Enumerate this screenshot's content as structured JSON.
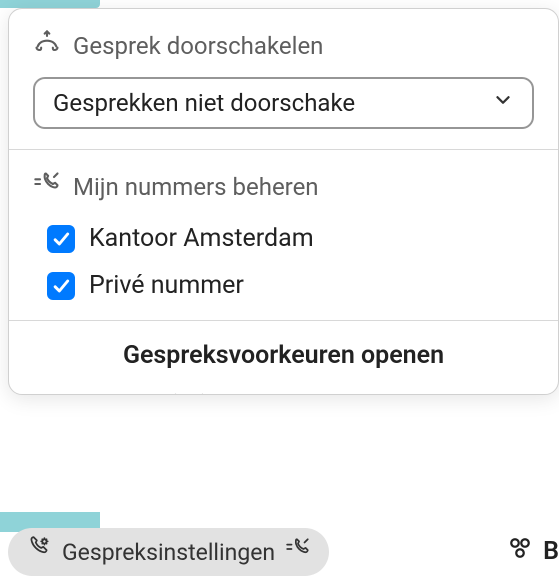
{
  "forward": {
    "title": "Gesprek doorschakelen",
    "selected": "Gesprekken niet doorschake"
  },
  "numbers": {
    "title": "Mijn nummers beheren",
    "items": [
      {
        "label": "Kantoor Amsterdam",
        "checked": true
      },
      {
        "label": "Privé nummer",
        "checked": true
      }
    ]
  },
  "open_prefs": "Gespreksvoorkeuren openen",
  "bottom": {
    "settings": "Gespreksinstellingen",
    "right_partial": "B"
  }
}
